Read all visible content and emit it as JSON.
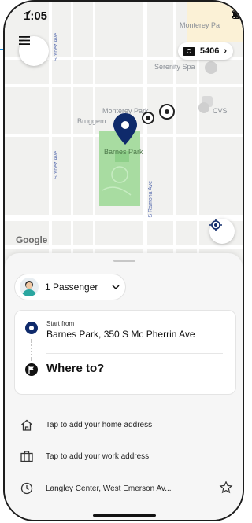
{
  "status_bar": {
    "time": "1:05",
    "location_arrow_icon": "location-arrow-icon",
    "signal_icon": "signal-icon",
    "wifi_icon": "wifi-icon",
    "battery_icon": "battery-icon"
  },
  "map": {
    "labels": {
      "monterey_pa": "Monterey Pa",
      "serenity_spa": "Serenity Spa",
      "monterey_park": "Monterey Park",
      "bruggem": "Bruggem",
      "cvs": "CVS",
      "barnes_park": "Barnes Park",
      "s_ynez_ave_top": "S Ynez Ave",
      "s_ynez_ave_mid": "S Ynez Ave",
      "s_ramona_ave": "S Ramona Ave",
      "google": "Google"
    },
    "pin_color": "#0f2a6b",
    "park_color": "#a8dca1"
  },
  "header": {
    "menu_icon": "hamburger-menu-icon",
    "ride_count": "5406",
    "ticket_icon": "ticket-icon",
    "chevron": "›"
  },
  "sheet": {
    "passenger_label": "1 Passenger",
    "start_from_label": "Start from",
    "start_address": "Barnes Park, 350 S Mc Pherrin Ave",
    "where_to": "Where to?",
    "home_row": "Tap to add your home address",
    "work_row": "Tap to add your work address",
    "recent_row": "Langley Center, West Emerson Av..."
  },
  "colors": {
    "accent_navy": "#0f2a6b",
    "highlight_arrow": "#1a8cd8"
  }
}
